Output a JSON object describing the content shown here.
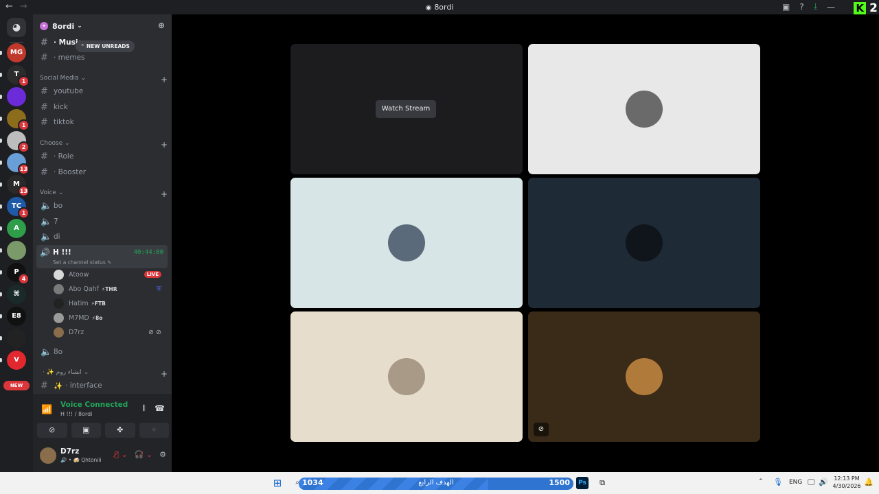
{
  "titlebar": {
    "back": "←",
    "forward": "→",
    "title": "8ordi",
    "kick_label": "2"
  },
  "rail": {
    "servers": [
      {
        "label": "MG",
        "color": "#c0392b",
        "badge": ""
      },
      {
        "label": "T",
        "color": "#2c2c2c",
        "badge": "1"
      },
      {
        "label": "",
        "color": "#6c2bd9",
        "badge": ""
      },
      {
        "label": "",
        "color": "#8b6d1b",
        "badge": "1"
      },
      {
        "label": "",
        "color": "#bdbdbd",
        "badge": "2"
      },
      {
        "label": "",
        "color": "#6a9ed6",
        "badge": "13"
      },
      {
        "label": "M",
        "color": "#2a2a2a",
        "badge": "13"
      },
      {
        "label": "TC",
        "color": "#1e5aa8",
        "badge": "1"
      },
      {
        "label": "A",
        "color": "#2e9e4a",
        "badge": ""
      },
      {
        "label": "",
        "color": "#7a9a6a",
        "badge": ""
      },
      {
        "label": "P",
        "color": "#111111",
        "badge": "4"
      },
      {
        "label": "⌘",
        "color": "#1a2a2a",
        "badge": ""
      },
      {
        "label": "E8",
        "color": "#111111",
        "badge": ""
      },
      {
        "label": "",
        "color": "#222222",
        "badge": ""
      },
      {
        "label": "V",
        "color": "#e0282e",
        "badge": ""
      }
    ],
    "new_label": "NEW"
  },
  "sidebar": {
    "server_name": "8ordi",
    "new_unreads": "NEW UNREADS",
    "top_channels": [
      {
        "name": "· Music",
        "bright": true
      },
      {
        "name": "· memes",
        "bright": false
      }
    ],
    "categories": [
      {
        "name": "Social Media",
        "channels": [
          "youtube",
          "kick",
          "tiktok"
        ]
      },
      {
        "name": "Choose",
        "channels": [
          "· Role",
          "· Booster"
        ]
      },
      {
        "name": "Voice",
        "channels": [
          "bo",
          "7",
          "di"
        ]
      }
    ],
    "active_voice": {
      "name": "H !!!",
      "timer": "40:44:00",
      "status": "Set a channel status"
    },
    "voice_users": [
      {
        "name": "Atoow",
        "tag": "",
        "right": "LIVE"
      },
      {
        "name": "Abo Qahf",
        "tag": "THR",
        "right": ""
      },
      {
        "name": "Hatim",
        "tag": "FTB",
        "right": ""
      },
      {
        "name": "M7MD",
        "tag": "8o",
        "right": ""
      },
      {
        "name": "D7rz",
        "tag": "",
        "right": ""
      }
    ],
    "after_voice": "8o",
    "bottom_category": "انشاء روم",
    "bottom_channel": "· interface",
    "voice_connected": "Voice Connected",
    "voice_location": "H !!! / 8ordi",
    "user": {
      "name": "D7rz",
      "status": "Qhtoniii"
    }
  },
  "stage": {
    "watch_stream": "Watch Stream",
    "tiles": [
      {
        "bg": "#1c1c1f",
        "kind": "stream"
      },
      {
        "bg": "#e8e8e8",
        "avatar": "#6a6a6a"
      },
      {
        "bg": "#d7e5e6",
        "avatar": "#5a6a7a"
      },
      {
        "bg": "#1e2a35",
        "avatar": "#0f151a"
      },
      {
        "bg": "#e6ddcc",
        "avatar": "#a89a86"
      },
      {
        "bg": "#3a2a18",
        "avatar": "#b07a3a",
        "muted": true
      }
    ]
  },
  "taskbar": {
    "goal_left": "1034",
    "goal_middle": "الهدف الرابع",
    "goal_right": "1500",
    "goal_progress": 0.69,
    "lang": "ENG",
    "time": "12:13 PM",
    "date": "4/30/2026"
  }
}
